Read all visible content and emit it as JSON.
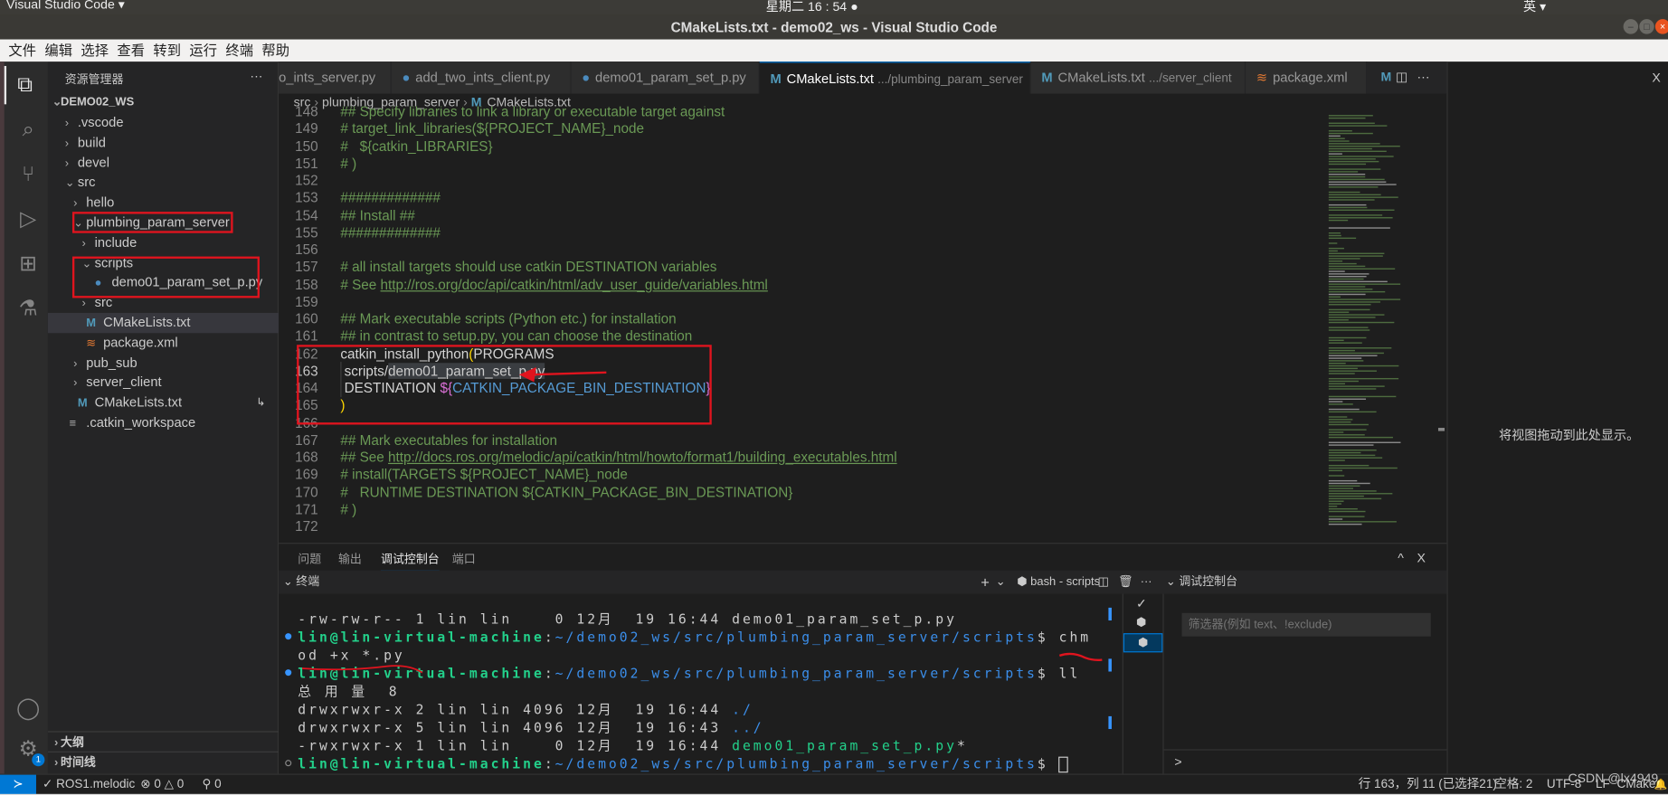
{
  "system": {
    "app_menu": "Visual Studio Code ▾",
    "clock": "星期二 16 : 54 ●",
    "ime": "英 ▾"
  },
  "window": {
    "title": "CMakeLists.txt - demo02_ws - Visual Studio Code"
  },
  "menu": [
    "文件",
    "编辑",
    "选择",
    "查看",
    "转到",
    "运行",
    "终端",
    "帮助"
  ],
  "activity": [
    {
      "name": "explorer-icon",
      "glyph": "⧉"
    },
    {
      "name": "search-icon",
      "glyph": "⌕"
    },
    {
      "name": "source-control-icon",
      "glyph": "⑂"
    },
    {
      "name": "run-debug-icon",
      "glyph": "▷"
    },
    {
      "name": "extensions-icon",
      "glyph": "⊞"
    },
    {
      "name": "testing-icon",
      "glyph": "⚗"
    }
  ],
  "activity_bottom": {
    "account_glyph": "◯",
    "manage_glyph": "⚙",
    "manage_badge": "1"
  },
  "sidebar": {
    "title": "资源管理器",
    "more": "···",
    "workspace": "DEMO02_WS",
    "items": [
      {
        "label": ".vscode",
        "icon": "chevron-right",
        "depth": 1
      },
      {
        "label": "build",
        "icon": "chevron-right",
        "depth": 1
      },
      {
        "label": "devel",
        "icon": "chevron-right",
        "depth": 1
      },
      {
        "label": "src",
        "icon": "chevron-down",
        "depth": 1
      },
      {
        "label": "hello",
        "icon": "chevron-right",
        "depth": 2
      },
      {
        "label": "plumbing_param_server",
        "icon": "chevron-down",
        "depth": 2
      },
      {
        "label": "include",
        "icon": "chevron-right",
        "depth": 3
      },
      {
        "label": "scripts",
        "icon": "chevron-down",
        "depth": 3
      },
      {
        "label": "demo01_param_set_p.py",
        "icon": "python",
        "depth": 4
      },
      {
        "label": "src",
        "icon": "chevron-right",
        "depth": 3
      },
      {
        "label": "CMakeLists.txt",
        "icon": "cmake",
        "depth": 3,
        "selected": true
      },
      {
        "label": "package.xml",
        "icon": "rss",
        "depth": 3
      },
      {
        "label": "pub_sub",
        "icon": "chevron-right",
        "depth": 2
      },
      {
        "label": "server_client",
        "icon": "chevron-right",
        "depth": 2
      },
      {
        "label": "CMakeLists.txt",
        "icon": "cmake",
        "depth": 2,
        "badge": "↳"
      },
      {
        "label": ".catkin_workspace",
        "icon": "lines",
        "depth": 1
      }
    ],
    "outline": "大纲",
    "timeline": "时间线"
  },
  "tabs": [
    {
      "label": "o_ints_server.py",
      "desc": "",
      "icon": "none"
    },
    {
      "label": "add_two_ints_client.py",
      "desc": "",
      "icon": "python"
    },
    {
      "label": "demo01_param_set_p.py",
      "desc": "",
      "icon": "python"
    },
    {
      "label": "CMakeLists.txt",
      "desc": ".../plumbing_param_server",
      "icon": "cmake",
      "active": true,
      "close": "X"
    },
    {
      "label": "CMakeLists.txt",
      "desc": ".../server_client",
      "icon": "cmake"
    },
    {
      "label": "package.xml",
      "desc": "",
      "icon": "rss"
    }
  ],
  "tab_actions": {
    "more": "···"
  },
  "breadcrumb": [
    "src",
    "plumbing_param_server",
    "CMakeLists.txt"
  ],
  "code": [
    {
      "n": "148",
      "s": [
        [
          "## Specify libraries to link a library or executable target against",
          "com"
        ]
      ]
    },
    {
      "n": "149",
      "s": [
        [
          "# target_link_libraries(${PROJECT_NAME}_node",
          "com"
        ]
      ]
    },
    {
      "n": "150",
      "s": [
        [
          "#   ${catkin_LIBRARIES}",
          "com"
        ]
      ]
    },
    {
      "n": "151",
      "s": [
        [
          "# )",
          "com"
        ]
      ]
    },
    {
      "n": "152",
      "s": []
    },
    {
      "n": "153",
      "s": [
        [
          "#############",
          "com"
        ]
      ]
    },
    {
      "n": "154",
      "s": [
        [
          "## Install ##",
          "com"
        ]
      ]
    },
    {
      "n": "155",
      "s": [
        [
          "#############",
          "com"
        ]
      ]
    },
    {
      "n": "156",
      "s": []
    },
    {
      "n": "157",
      "s": [
        [
          "# all install targets should use catkin DESTINATION variables",
          "com"
        ]
      ]
    },
    {
      "n": "158",
      "s": [
        [
          "# See ",
          "com"
        ],
        [
          "http://ros.org/doc/api/catkin/html/adv_user_guide/variables.html",
          "link"
        ]
      ]
    },
    {
      "n": "159",
      "s": []
    },
    {
      "n": "160",
      "s": [
        [
          "## Mark executable scripts (Python etc.) for installation",
          "com"
        ]
      ]
    },
    {
      "n": "161",
      "s": [
        [
          "## in contrast to setup.py, you can choose the destination",
          "com"
        ]
      ]
    },
    {
      "n": "162",
      "s": [
        [
          "catkin_install_python",
          "fn"
        ],
        [
          "(",
          "par"
        ],
        [
          "PROGRAMS",
          "pl"
        ]
      ]
    },
    {
      "n": "163",
      "s": [
        [
          " scripts/",
          "pl"
        ],
        [
          "demo01_param_set_p.py",
          "sel"
        ]
      ],
      "current": true
    },
    {
      "n": "164",
      "s": [
        [
          " DESTINATION ",
          "pl"
        ],
        [
          "${",
          "brace"
        ],
        [
          "CATKIN_PACKAGE_BIN_DESTINATION",
          "var"
        ],
        [
          "}",
          "brace"
        ]
      ]
    },
    {
      "n": "165",
      "s": [
        [
          ")",
          "par"
        ]
      ]
    },
    {
      "n": "166",
      "s": []
    },
    {
      "n": "167",
      "s": [
        [
          "## Mark executables for installation",
          "com"
        ]
      ]
    },
    {
      "n": "168",
      "s": [
        [
          "## See ",
          "com"
        ],
        [
          "http://docs.ros.org/melodic/api/catkin/html/howto/format1/building_executables.html",
          "link"
        ]
      ]
    },
    {
      "n": "169",
      "s": [
        [
          "# install(TARGETS ${PROJECT_NAME}_node",
          "com"
        ]
      ]
    },
    {
      "n": "170",
      "s": [
        [
          "#   RUNTIME DESTINATION ${CATKIN_PACKAGE_BIN_DESTINATION}",
          "com"
        ]
      ]
    },
    {
      "n": "171",
      "s": [
        [
          "# )",
          "com"
        ]
      ]
    },
    {
      "n": "172",
      "s": []
    }
  ],
  "right_panel": {
    "hint": "将视图拖动到此处显示。",
    "close": "X"
  },
  "panel": {
    "tabs": [
      "问题",
      "输出",
      "调试控制台",
      "端口"
    ],
    "active_tab": 2,
    "maximize": "^",
    "close": "X",
    "terminal_title": "终端",
    "new_terminal": "+",
    "terminal_name": "bash - scripts",
    "more": "···",
    "debug_title": "调试控制台",
    "filter_placeholder": "筛选器(例如 text、!exclude)",
    "debug_prompt": ">"
  },
  "terminal": [
    {
      "dot": false,
      "s": [
        [
          "-rw-rw-r-- 1 lin lin    0 12月  19 16:44 demo01_param_set_p.py",
          ""
        ]
      ]
    },
    {
      "dot": true,
      "s": [
        [
          "lin@lin-virtual-machine",
          "g"
        ],
        [
          ":",
          ""
        ],
        [
          "~/demo02_ws/src/plumbing_param_server/scripts",
          "b"
        ],
        [
          "$ chm",
          ""
        ]
      ]
    },
    {
      "dot": false,
      "s": [
        [
          "od +x *.py",
          ""
        ]
      ]
    },
    {
      "dot": true,
      "s": [
        [
          "lin@lin-virtual-machine",
          "g"
        ],
        [
          ":",
          ""
        ],
        [
          "~/demo02_ws/src/plumbing_param_server/scripts",
          "b"
        ],
        [
          "$ ll",
          ""
        ]
      ]
    },
    {
      "dot": false,
      "s": [
        [
          "总 用 量  8",
          ""
        ]
      ]
    },
    {
      "dot": false,
      "s": [
        [
          "drwxrwxr-x 2 lin lin 4096 12月  19 16:44 ",
          ""
        ],
        [
          "./",
          "b"
        ]
      ]
    },
    {
      "dot": false,
      "s": [
        [
          "drwxrwxr-x 5 lin lin 4096 12月  19 16:43 ",
          ""
        ],
        [
          "../",
          "b"
        ]
      ]
    },
    {
      "dot": false,
      "s": [
        [
          "-rwxrwxr-x 1 lin lin    0 12月  19 16:44 ",
          ""
        ],
        [
          "demo01_param_set_p.py",
          "gn"
        ],
        [
          "*",
          ""
        ]
      ]
    },
    {
      "dot": true,
      "s": [
        [
          "lin@lin-virtual-machine",
          "g"
        ],
        [
          ":",
          ""
        ],
        [
          "~/demo02_ws/src/plumbing_param_server/scripts",
          "b"
        ],
        [
          "$ ",
          ""
        ]
      ]
    }
  ],
  "status": {
    "remote": "≻",
    "ros": "✓ ROS1.melodic",
    "problems": "⊗ 0 △ 0",
    "ports": "⚲ 0",
    "position": "行 163，列 11 (已选择21)",
    "indent": "空格: 2",
    "encoding": "UTF-8",
    "eol": "LF",
    "language": "CMake",
    "bell": "🔔"
  },
  "watermark": "CSDN @lx4949",
  "colors": {
    "accent": "#0078d4",
    "annotation_red": "#e0141e",
    "comment": "#6a9955",
    "prompt_green": "#23d18b",
    "path_blue": "#3b8eea"
  }
}
